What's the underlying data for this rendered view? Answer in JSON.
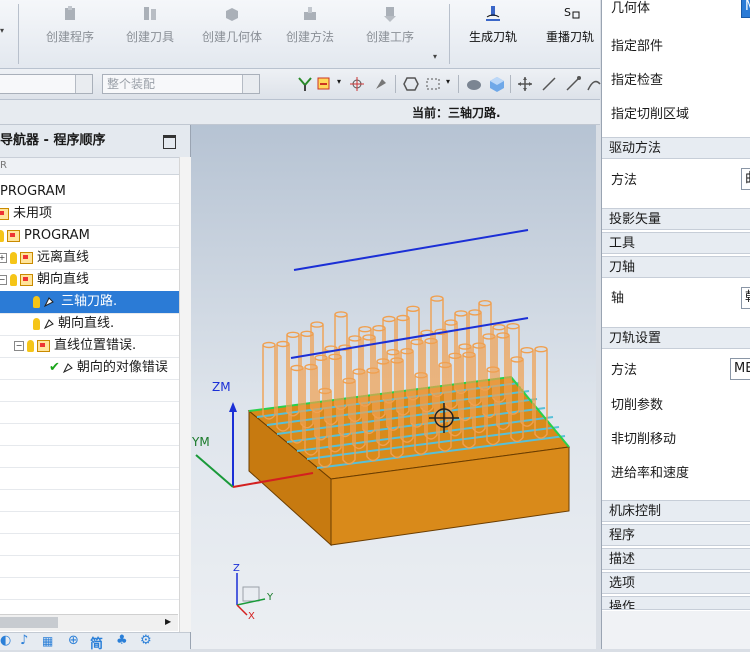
{
  "ribbon": {
    "buttons": [
      {
        "label": "创建程序",
        "icon": "create-program-icon"
      },
      {
        "label": "创建刀具",
        "icon": "create-tool-icon"
      },
      {
        "label": "创建几何体",
        "icon": "create-geometry-icon"
      },
      {
        "label": "创建方法",
        "icon": "create-method-icon"
      },
      {
        "label": "创建工序",
        "icon": "create-operation-icon"
      },
      {
        "label": "生成刀轨",
        "icon": "generate-toolpath-icon"
      },
      {
        "label": "重播刀轨",
        "icon": "replay-toolpath-icon"
      }
    ]
  },
  "toolbar": {
    "assembly_combo": "整个装配"
  },
  "status": {
    "current": "当前：三轴刀路."
  },
  "navigator": {
    "title": "导航器 - 程序顺序",
    "column": "R",
    "rows": [
      {
        "label": "PROGRAM"
      },
      {
        "label": "未用项"
      },
      {
        "label": "PROGRAM"
      },
      {
        "label": "远离直线"
      },
      {
        "label": "朝向直线"
      },
      {
        "label": "三轴刀路."
      },
      {
        "label": "朝向直线."
      },
      {
        "label": "直线位置错误."
      },
      {
        "label": "朝向的对像错误"
      }
    ]
  },
  "viewport": {
    "axis_zm": "ZM",
    "axis_ym": "YM",
    "triad_z": "Z",
    "triad_y": "Y",
    "triad_x": "X"
  },
  "panel": {
    "geometry_label": "几何体",
    "geometry_value": "MC",
    "items_top": [
      "指定部件",
      "指定检查",
      "指定切削区域"
    ],
    "drive_section": "驱动方法",
    "drive_method_label": "方法",
    "drive_method_value": "曲",
    "proj_section": "投影矢量",
    "tool_section": "工具",
    "axis_section": "刀轴",
    "axis_label": "轴",
    "axis_value": "朝",
    "path_section": "刀轨设置",
    "path_method_label": "方法",
    "path_method_value": "ME",
    "cut_params": "切削参数",
    "noncut_moves": "非切削移动",
    "feeds_speeds": "进给率和速度",
    "machine_section": "机床控制",
    "program_section": "程序",
    "desc_section": "描述",
    "options_section": "选项",
    "ops_section": "操作"
  },
  "colors": {
    "accent": "#2b7bd6",
    "part_orange": "#d98a1a",
    "tool_orange": "#f0a050",
    "path_blue": "#1b2fd6"
  }
}
